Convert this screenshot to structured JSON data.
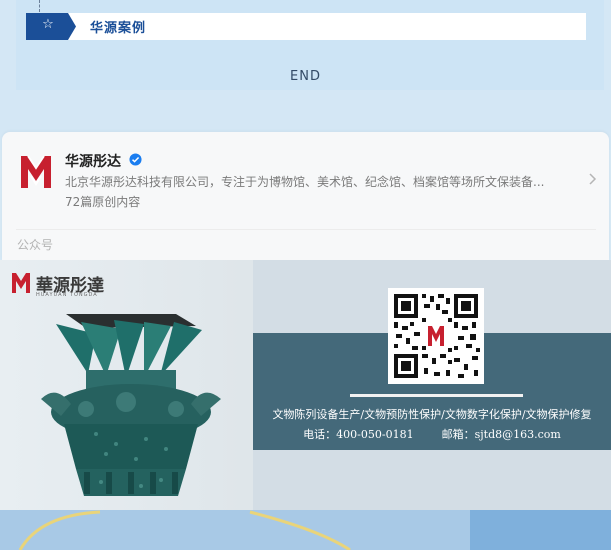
{
  "section": {
    "title": "华源案例",
    "star_icon": "star-icon"
  },
  "end_label": "END",
  "account": {
    "name": "华源彤达",
    "description": "北京华源彤达科技有限公司，专注于为博物馆、美术馆、纪念馆、档案馆等场所文保装备...",
    "article_count": "72篇原创内容",
    "type_label": "公众号",
    "logo_icon": "huayuan-logo",
    "verified_icon": "verified-badge-icon",
    "chevron_icon": "chevron-right-icon"
  },
  "banner": {
    "brand_name": "華源彤達",
    "brand_sub": "HUAYUAN TONGDA",
    "services": "文物陈列设备生产/文物预防性保护/文物数字化保护/文物保护修复",
    "phone": "电话：400-050-0181",
    "email": "邮箱：sjtd8@163.com",
    "qr_icon": "qr-code-icon",
    "vessel_image": "bronze-vessel-image"
  },
  "colors": {
    "brand_blue": "#1b4f98",
    "brand_red": "#c7202f",
    "strip": "#44697a",
    "verified": "#1a7df0"
  }
}
